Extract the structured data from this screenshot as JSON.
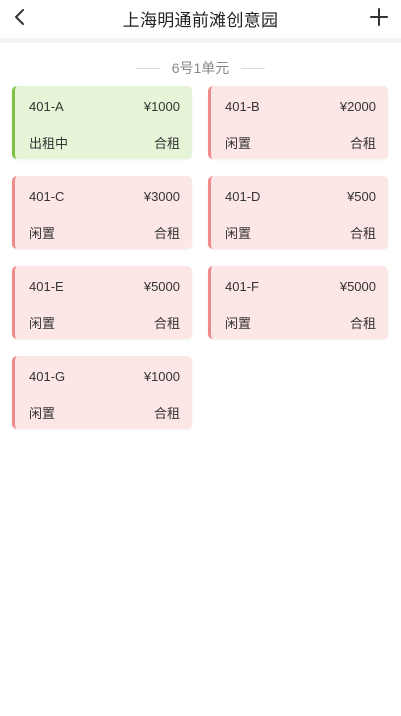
{
  "header": {
    "title": "上海明通前滩创意园",
    "back_icon": "chevron-left-icon",
    "add_icon": "plus-icon"
  },
  "section": {
    "title": "6号1单元"
  },
  "units": [
    {
      "name": "401-A",
      "price": "¥1000",
      "status": "出租中",
      "rent_type": "合租",
      "state": "rented"
    },
    {
      "name": "401-B",
      "price": "¥2000",
      "status": "闲置",
      "rent_type": "合租",
      "state": "vacant"
    },
    {
      "name": "401-C",
      "price": "¥3000",
      "status": "闲置",
      "rent_type": "合租",
      "state": "vacant"
    },
    {
      "name": "401-D",
      "price": "¥500",
      "status": "闲置",
      "rent_type": "合租",
      "state": "vacant"
    },
    {
      "name": "401-E",
      "price": "¥5000",
      "status": "闲置",
      "rent_type": "合租",
      "state": "vacant"
    },
    {
      "name": "401-F",
      "price": "¥5000",
      "status": "闲置",
      "rent_type": "合租",
      "state": "vacant"
    },
    {
      "name": "401-G",
      "price": "¥1000",
      "status": "闲置",
      "rent_type": "合租",
      "state": "vacant"
    }
  ],
  "colors": {
    "rented_bg": "#e6f5d7",
    "rented_accent": "#7dc244",
    "vacant_bg": "#fde6e6",
    "vacant_accent": "#ef8a8a"
  }
}
